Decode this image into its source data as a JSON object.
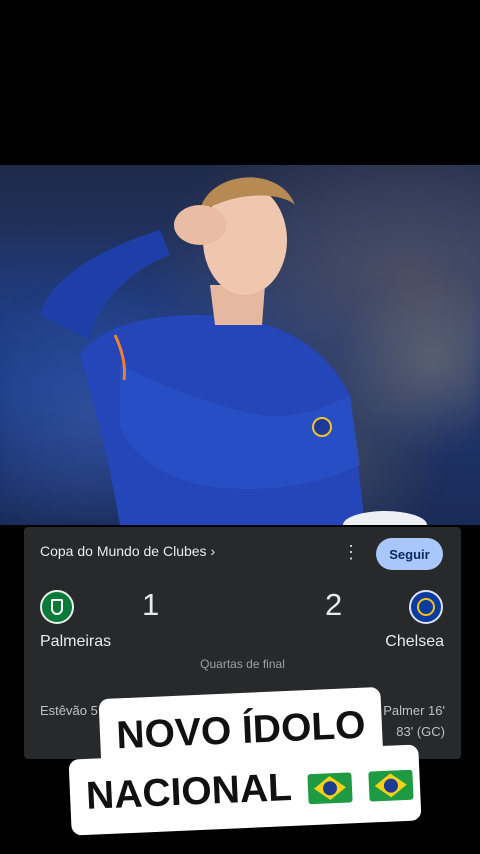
{
  "card": {
    "competition": "Copa do Mundo de Clubes ›",
    "more_icon": "more-vert-icon",
    "follow_label": "Seguir",
    "home": {
      "name": "Palmeiras",
      "score": "1",
      "crest_icon": "palmeiras-crest-icon",
      "scorers": [
        "Estêvão 5"
      ]
    },
    "away": {
      "name": "Chelsea",
      "score": "2",
      "crest_icon": "chelsea-crest-icon",
      "scorers": [
        "Palmer 16'",
        "83' (GC)"
      ]
    },
    "stage": "Quartas de final"
  },
  "overlay": {
    "line1": "NOVO ÍDOLO",
    "line2": "NACIONAL",
    "flag_icon": "brazil-flag-icon"
  },
  "colors": {
    "card_bg": "#28292b",
    "follow_bg": "#a8c7fa",
    "sticker_bg": "#ffffff"
  }
}
